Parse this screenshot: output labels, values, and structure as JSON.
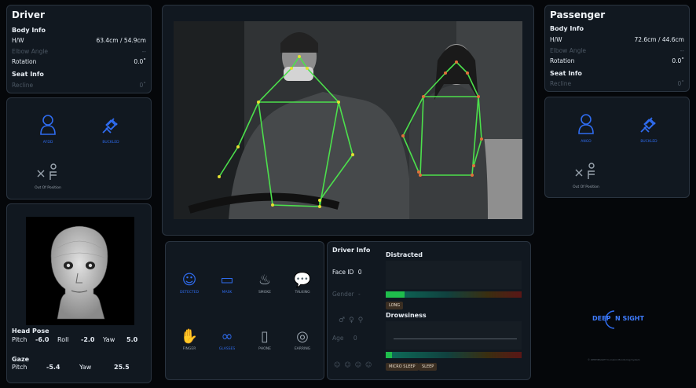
{
  "driver": {
    "title": "Driver",
    "body_info_label": "Body Info",
    "rows": [
      {
        "label": "H/W",
        "value": "63.4cm / 54.9cm",
        "dim": false
      },
      {
        "label": "Elbow Angle",
        "value": "--",
        "dim": true
      },
      {
        "label": "Rotation",
        "value": "0.0˚",
        "dim": false
      }
    ],
    "seat_info_label": "Seat Info",
    "seat_rows": [
      {
        "label": "Recline",
        "value": "0˚",
        "dim": true
      }
    ],
    "icons": [
      {
        "label": "AFDD",
        "icon": "person-icon"
      },
      {
        "label": "BUCKLED",
        "icon": "seatbelt-icon"
      },
      {
        "label": "Out Of Position",
        "icon": "out-of-position-icon"
      }
    ]
  },
  "passenger": {
    "title": "Passenger",
    "body_info_label": "Body Info",
    "rows": [
      {
        "label": "H/W",
        "value": "72.6cm / 44.6cm",
        "dim": false
      },
      {
        "label": "Elbow Angle",
        "value": "--",
        "dim": true
      },
      {
        "label": "Rotation",
        "value": "0.0˚",
        "dim": false
      }
    ],
    "seat_info_label": "Seat Info",
    "seat_rows": [
      {
        "label": "Recline",
        "value": "0˚",
        "dim": true
      }
    ],
    "icons": [
      {
        "label": "ANGO",
        "icon": "person-icon"
      },
      {
        "label": "BUCKLED",
        "icon": "seatbelt-icon"
      },
      {
        "label": "Out Of Position",
        "icon": "out-of-position-icon"
      }
    ]
  },
  "head_pose": {
    "label": "Head Pose",
    "pitch_label": "Pitch",
    "pitch": "-6.0",
    "roll_label": "Roll",
    "roll": "-2.0",
    "yaw_label": "Yaw",
    "yaw": "5.0"
  },
  "gaze": {
    "label": "Gaze",
    "pitch_label": "Pitch",
    "pitch": "-5.4",
    "yaw_label": "Yaw",
    "yaw": "25.5"
  },
  "activities": [
    {
      "label": "DETECTED",
      "icon": "face-detect-icon",
      "active": true
    },
    {
      "label": "MASK",
      "icon": "mask-icon",
      "active": true
    },
    {
      "label": "SMOKE",
      "icon": "smoke-icon",
      "active": false
    },
    {
      "label": "TALKING",
      "icon": "talking-icon",
      "active": false
    },
    {
      "label": "FINGER",
      "icon": "finger-icon",
      "active": false
    },
    {
      "label": "GLASSES",
      "icon": "glasses-icon",
      "active": true
    },
    {
      "label": "PHONE",
      "icon": "phone-icon",
      "active": false
    },
    {
      "label": "EARRING",
      "icon": "earring-icon",
      "active": false
    }
  ],
  "driver_info": {
    "title": "Driver Info",
    "face_id_label": "Face ID",
    "face_id": "0",
    "gender_label": "Gender",
    "gender": "-",
    "age_label": "Age",
    "age": "0"
  },
  "distracted": {
    "label": "Distracted",
    "buttons": [
      "LONG"
    ]
  },
  "drowsiness": {
    "label": "Drowsiness",
    "buttons": [
      "MICRO SLEEP",
      "SLEEP"
    ]
  },
  "brand": {
    "logo_text": "DEEP  N SIGHT",
    "footer": "© DEEPINSIGHT In-Cabin Monitoring System"
  },
  "colors": {
    "accent": "#2f6cf0",
    "skeleton": "#4ce04c",
    "joint": "#e5e031"
  }
}
